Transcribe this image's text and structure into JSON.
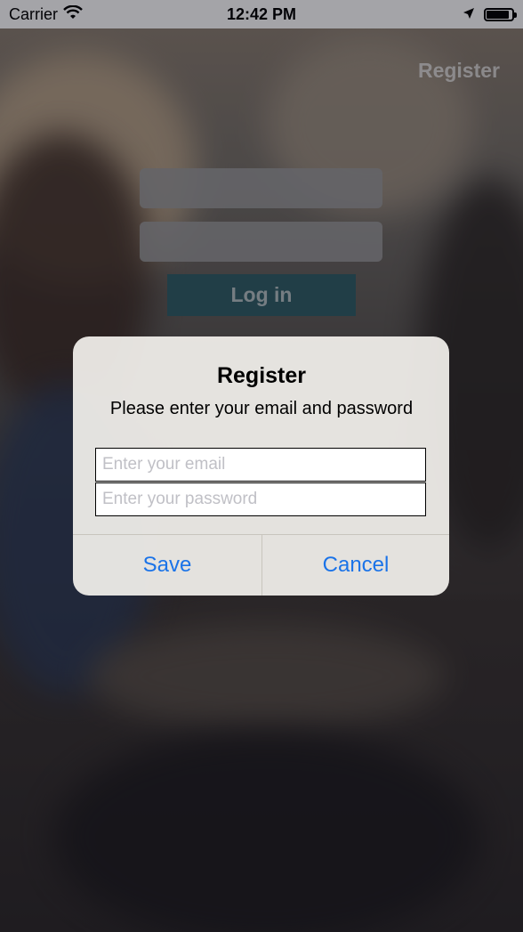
{
  "status_bar": {
    "carrier": "Carrier",
    "time": "12:42 PM",
    "battery_level": 0.9
  },
  "header": {
    "register_label": "Register"
  },
  "login": {
    "login_label": "Log in"
  },
  "alert": {
    "title": "Register",
    "message": "Please enter your email and password",
    "email_placeholder": "Enter your email",
    "password_placeholder": "Enter your password",
    "save_label": "Save",
    "cancel_label": "Cancel",
    "button_color": "#1a73e8"
  }
}
